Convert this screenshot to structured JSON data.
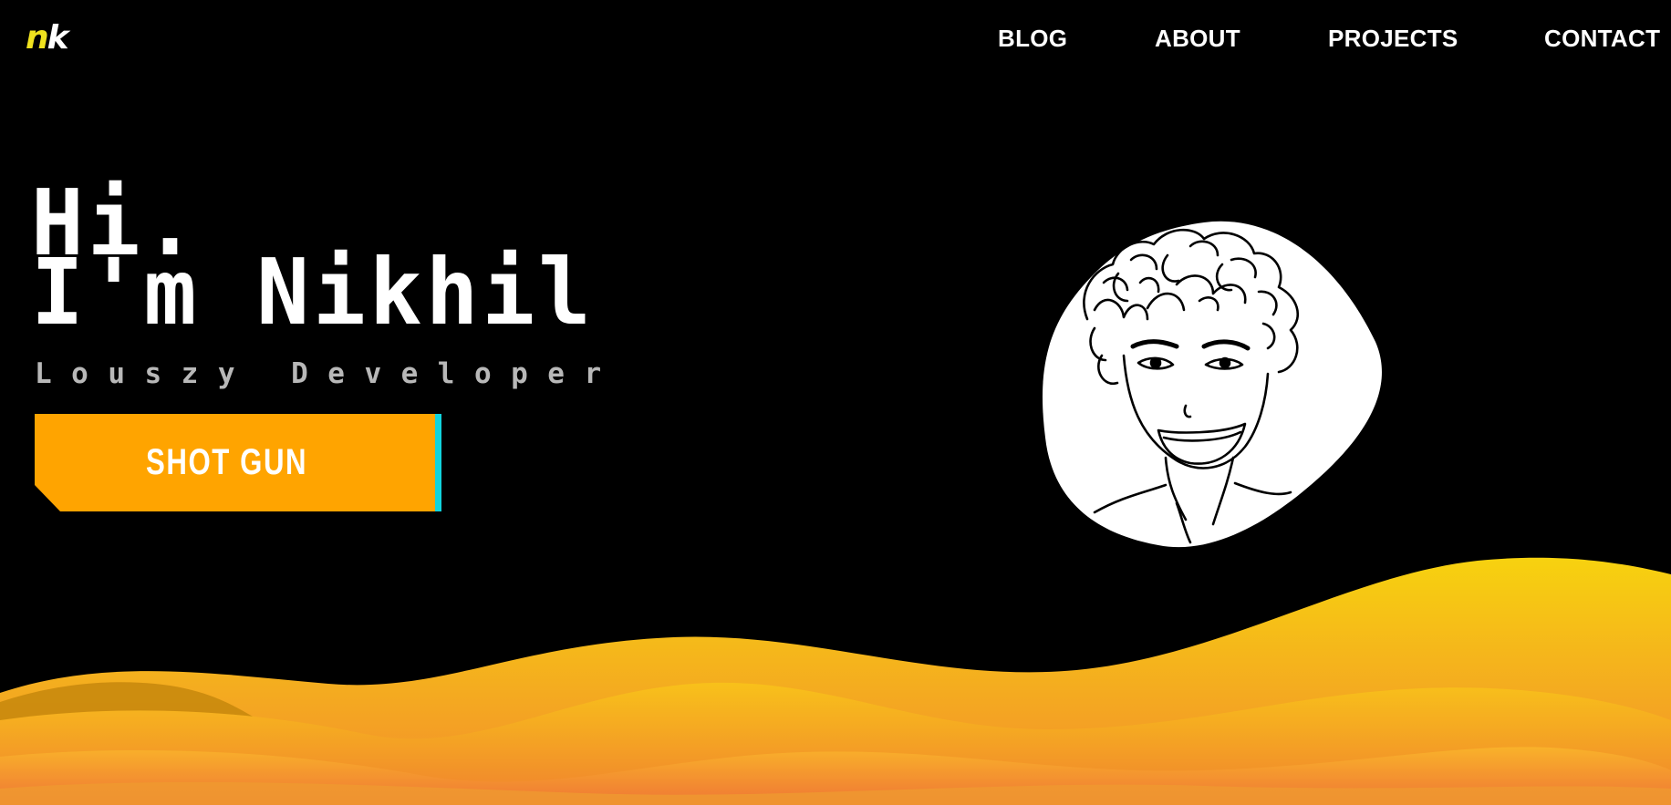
{
  "header": {
    "logo": {
      "part1": "n",
      "part2": "k"
    },
    "nav": [
      {
        "label": "BLOG"
      },
      {
        "label": "ABOUT"
      },
      {
        "label": "PROJECTS"
      },
      {
        "label": "CONTACT"
      }
    ]
  },
  "hero": {
    "greeting_line1": "Hi.",
    "greeting_line2": "I'm Nikhil",
    "subtitle": "Louszy Developer",
    "cta_label": "SHOT GUN"
  },
  "avatar": {
    "icon": "avatar-sketch-icon"
  },
  "colors": {
    "background": "#000000",
    "accent": "#ffa400",
    "cta_edge": "#11d4de",
    "logo_yellow": "#f0e21e",
    "wave_top": "#f6d20f",
    "wave_bottom": "#f07b36"
  }
}
